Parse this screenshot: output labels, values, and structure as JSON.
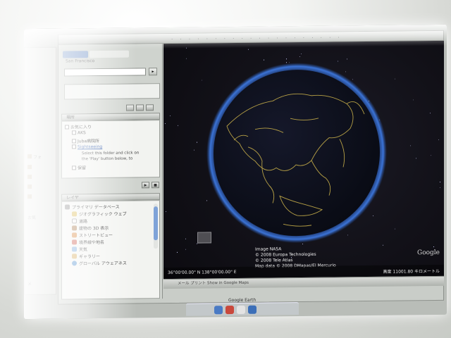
{
  "app": {
    "dock_label": "Google Earth"
  },
  "search": {
    "tabs": [
      "",
      ""
    ],
    "label": "San Francisco",
    "input_value": "",
    "go_label": "▸"
  },
  "places": {
    "header": "場所",
    "items": [
      {
        "label": "お気に入り"
      },
      {
        "label": "AKS"
      },
      {
        "label": "Juba病院所"
      },
      {
        "label": "Sightseeing"
      },
      {
        "label": "保留"
      }
    ],
    "note_line1": "Select this folder and click on",
    "note_line2": "the 'Play' button below, to"
  },
  "layers": {
    "header": "レイヤ",
    "items": [
      {
        "label": "プライマリ データベース"
      },
      {
        "label": "ジオグラフィック ウェブ"
      },
      {
        "label": "道路"
      },
      {
        "label": "建物の 3D 表示"
      },
      {
        "label": "ストリートビュー"
      },
      {
        "label": "境界線や地名"
      },
      {
        "label": "天気"
      },
      {
        "label": "ギャラリー"
      },
      {
        "label": "グローバル アウェアネス"
      }
    ]
  },
  "left_stub": {
    "rows": [
      "フォ",
      "",
      "",
      "",
      "",
      "お気",
      "メ"
    ]
  },
  "map": {
    "credits": [
      "Image NASA",
      "© 2008 Europa Technologies",
      "© 2008 Tele Atlas",
      "Map data © 2008 DMapas/El Mercurio"
    ],
    "google_logo": "Google",
    "coords": "36°00'00.00\" N  138°00'00.00\" E",
    "altitude": "高度 11001.80 キロメートル"
  },
  "bottom_bar": {
    "text": "メール  プリント  Show in Google Maps"
  }
}
